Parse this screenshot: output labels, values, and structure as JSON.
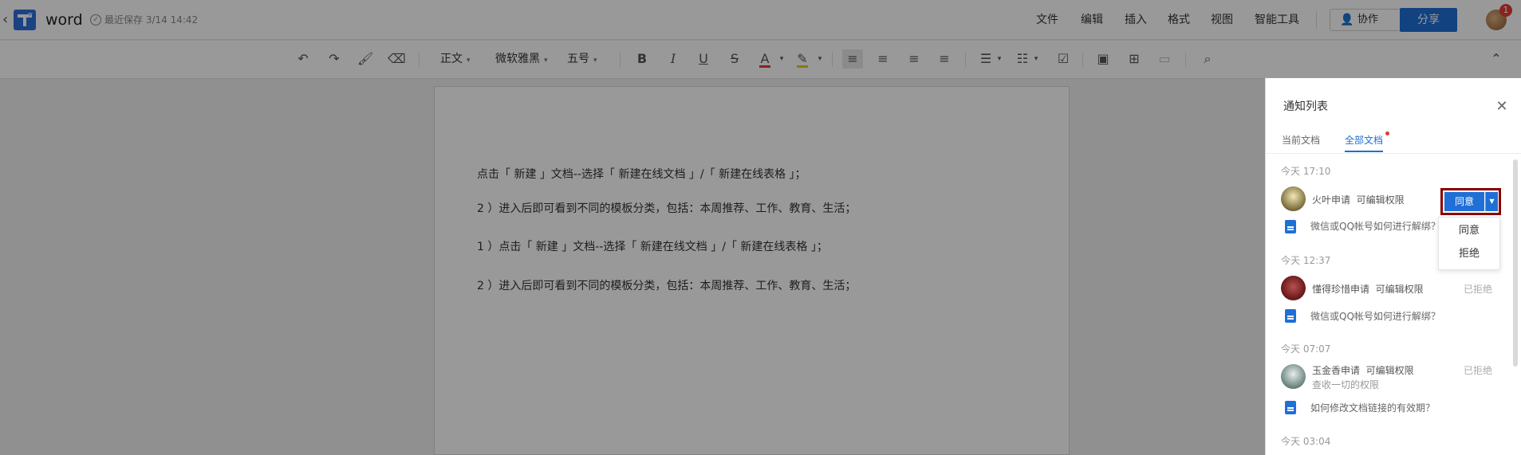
{
  "header": {
    "title": "word",
    "save_status": "最近保存 3/14 14:42",
    "menus": [
      "文件",
      "编辑",
      "插入",
      "格式",
      "视图",
      "智能工具"
    ],
    "collab_label": "协作",
    "share_label": "分享",
    "notification_count": "1"
  },
  "toolbar": {
    "style_select": "正文",
    "font_select": "微软雅黑",
    "size_select": "五号",
    "bold": "B",
    "italic": "I",
    "underline": "U",
    "strike": "S",
    "font_color": "A",
    "accent_color": "#e53935",
    "highlight_color": "#f0c419"
  },
  "document": {
    "lines": [
      "点击「 新建 」文档--选择「 新建在线文档 」/「 新建在线表格 」；",
      "2 ）进入后即可看到不同的模板分类，包括：本周推荐、工作、教育、生活；",
      "1 ）点击「 新建 」文档--选择「 新建在线文档 」/「 新建在线表格 」；",
      "2 ）进入后即可看到不同的模板分类，包括：本周推荐、工作、教育、生活；"
    ]
  },
  "panel": {
    "title": "通知列表",
    "tabs": [
      "当前文档",
      "全部文档"
    ],
    "groups": [
      {
        "date": "今天 17:10",
        "requester": "火叶申请",
        "permission": "可编辑权限",
        "doc": "微信或QQ帐号如何进行解绑？",
        "action": "同意",
        "dropdown": [
          "同意",
          "拒绝"
        ]
      },
      {
        "date": "今天 12:37",
        "requester": "懂得珍惜申请",
        "permission": "可编辑权限",
        "status": "已拒绝",
        "doc": "微信或QQ帐号如何进行解绑？"
      },
      {
        "date": "今天 07:07",
        "requester": "玉金香申请",
        "permission": "可编辑权限",
        "status": "已拒绝",
        "note": "查收一切的权限",
        "doc": "如何修改文档链接的有效期？"
      },
      {
        "date": "今天 03:04"
      }
    ],
    "brand_color": "#1f6fd6"
  }
}
